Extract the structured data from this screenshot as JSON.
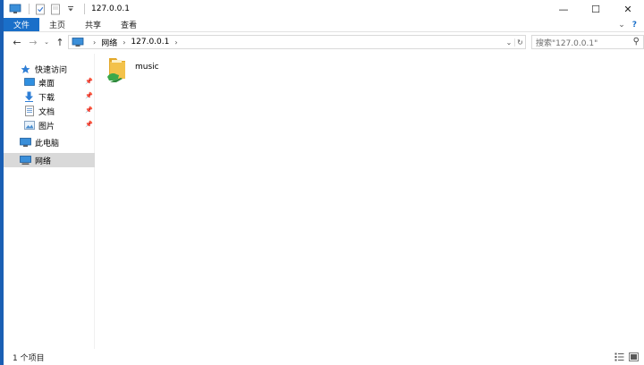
{
  "window": {
    "title": "127.0.0.1",
    "controls": {
      "minimize": "—",
      "maximize": "☐",
      "close": "✕"
    }
  },
  "ribbon": {
    "tabs": [
      {
        "label": "文件",
        "active": true
      },
      {
        "label": "主页"
      },
      {
        "label": "共享"
      },
      {
        "label": "查看"
      }
    ],
    "expand_glyph": "⌄",
    "help_glyph": "?"
  },
  "navigation": {
    "back": "←",
    "forward": "→",
    "recent": "⌄",
    "up": "↑",
    "breadcrumb": [
      "网络",
      "127.0.0.1"
    ],
    "dropdown": "⌄",
    "refresh": "↻",
    "search_placeholder": "搜索\"127.0.0.1\"",
    "search_icon": "⚲"
  },
  "sidebar": {
    "quick_access": {
      "label": "快速访问",
      "icon": "star-icon"
    },
    "pinned": [
      {
        "label": "桌面",
        "icon": "desktop-icon"
      },
      {
        "label": "下载",
        "icon": "download-icon"
      },
      {
        "label": "文档",
        "icon": "document-icon"
      },
      {
        "label": "图片",
        "icon": "picture-icon"
      }
    ],
    "this_pc": {
      "label": "此电脑",
      "icon": "computer-icon"
    },
    "network": {
      "label": "网络",
      "icon": "network-icon",
      "selected": true
    }
  },
  "content": {
    "items": [
      {
        "name": "music",
        "icon": "shared-folder-icon"
      }
    ]
  },
  "status": {
    "item_count": "1 个项目"
  },
  "colors": {
    "accent": "#1a6fc9",
    "selection": "#d9d9d9",
    "folder": "#f3c24a",
    "share": "#3aa84a"
  }
}
